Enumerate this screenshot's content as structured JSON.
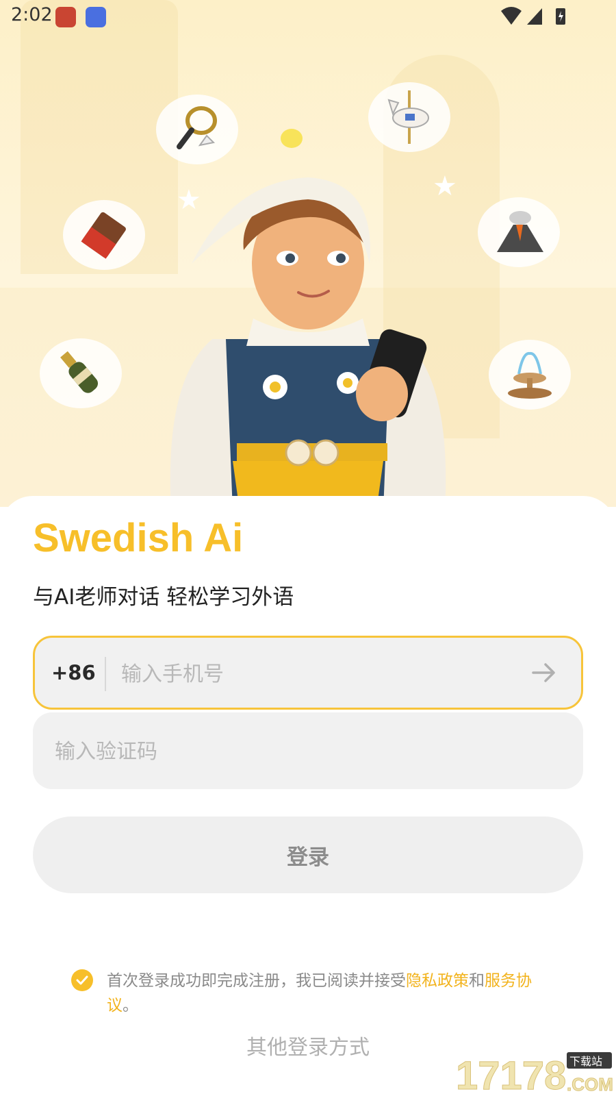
{
  "status_bar": {
    "time": "2:02"
  },
  "hero": {
    "bubble_icons": [
      "badminton-icon",
      "carousel-horse-icon",
      "chocolate-icon",
      "volcano-icon",
      "champagne-icon",
      "fountain-icon"
    ]
  },
  "app": {
    "title": "Swedish Ai",
    "subtitle": "与AI老师对话 轻松学习外语"
  },
  "login": {
    "country_code": "+86",
    "phone_placeholder": "输入手机号",
    "code_placeholder": "输入验证码",
    "login_label": "登录",
    "agreement_prefix": "首次登录成功即完成注册，我已阅读并接受",
    "privacy_link": "隐私政策",
    "and": "和",
    "service_link": "服务协议",
    "suffix": "。",
    "other_methods": "其他登录方式"
  },
  "watermark": {
    "text": "17178",
    "small_text": "下载站",
    "domain": ".COM"
  },
  "colors": {
    "accent": "#f7bf2a",
    "field_bg": "#f1f1f1",
    "hero_bg": "#fdf0c8"
  }
}
